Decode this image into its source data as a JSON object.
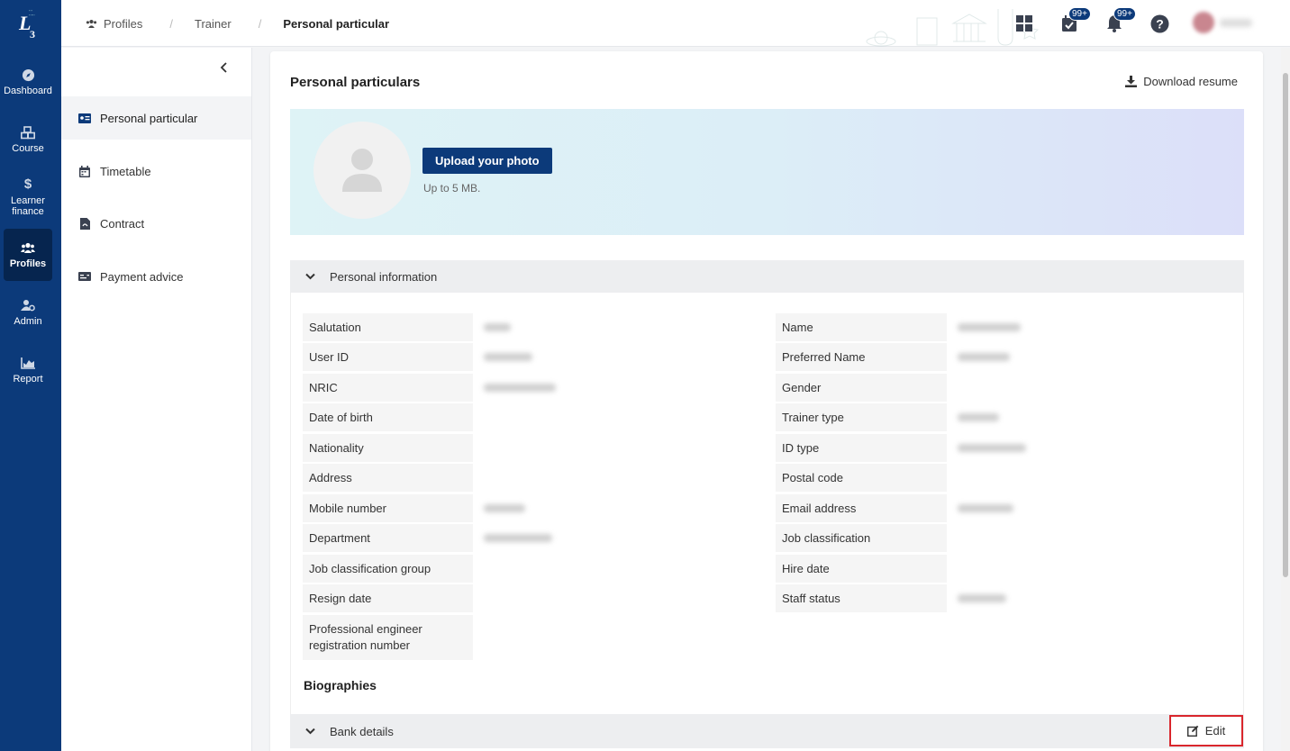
{
  "nav": {
    "logo_text": "L",
    "logo_num": "3",
    "items": [
      {
        "label": "Dashboard",
        "icon": "compass-icon"
      },
      {
        "label": "Course",
        "icon": "cubes-icon"
      },
      {
        "label": "Learner finance",
        "icon": "dollar-icon"
      },
      {
        "label": "Profiles",
        "icon": "users-icon",
        "active": true
      },
      {
        "label": "Admin",
        "icon": "user-gear-icon"
      },
      {
        "label": "Report",
        "icon": "chart-area-icon"
      }
    ]
  },
  "header": {
    "breadcrumb": {
      "root": "Profiles",
      "middle": "Trainer",
      "current": "Personal particular"
    },
    "tasks_badge": "99+",
    "notifications_badge": "99+"
  },
  "subnav": {
    "items": [
      {
        "label": "Personal particular",
        "icon": "id-card-icon",
        "active": true
      },
      {
        "label": "Timetable",
        "icon": "calendar-icon"
      },
      {
        "label": "Contract",
        "icon": "file-pdf-icon"
      },
      {
        "label": "Payment advice",
        "icon": "money-check-icon"
      }
    ]
  },
  "main": {
    "title": "Personal particulars",
    "download_label": "Download resume",
    "upload_label": "Upload your photo",
    "upload_hint": "Up to 5 MB.",
    "personal_info": {
      "heading": "Personal information",
      "left": [
        {
          "label": "Salutation",
          "value_blurred": true
        },
        {
          "label": "User ID",
          "value_blurred": true
        },
        {
          "label": "NRIC",
          "value_blurred": true
        },
        {
          "label": "Date of birth",
          "value_blurred": false
        },
        {
          "label": "Nationality",
          "value_blurred": false
        },
        {
          "label": "Address",
          "value_blurred": false
        },
        {
          "label": "Mobile number",
          "value_blurred": true
        },
        {
          "label": "Department",
          "value_blurred": true
        },
        {
          "label": "Job classification group",
          "value_blurred": false
        },
        {
          "label": "Resign date",
          "value_blurred": false
        },
        {
          "label": "Professional engineer registration number",
          "value_blurred": false
        }
      ],
      "right": [
        {
          "label": "Name",
          "value_blurred": true
        },
        {
          "label": "Preferred Name",
          "value_blurred": true
        },
        {
          "label": "Gender",
          "value_blurred": false
        },
        {
          "label": "Trainer type",
          "value_blurred": true
        },
        {
          "label": "ID type",
          "value_blurred": true
        },
        {
          "label": "Postal code",
          "value_blurred": false
        },
        {
          "label": "Email address",
          "value_blurred": true
        },
        {
          "label": "Job classification",
          "value_blurred": false
        },
        {
          "label": "Hire date",
          "value_blurred": false
        },
        {
          "label": "Staff status",
          "value_blurred": true
        }
      ]
    },
    "biographies_heading": "Biographies",
    "bank_details_heading": "Bank details",
    "edit_label": "Edit"
  },
  "colors": {
    "nav_bg": "#0c3a7a",
    "nav_active": "#06254f",
    "accent": "#0c3a7a",
    "edit_highlight": "#d9262c"
  }
}
